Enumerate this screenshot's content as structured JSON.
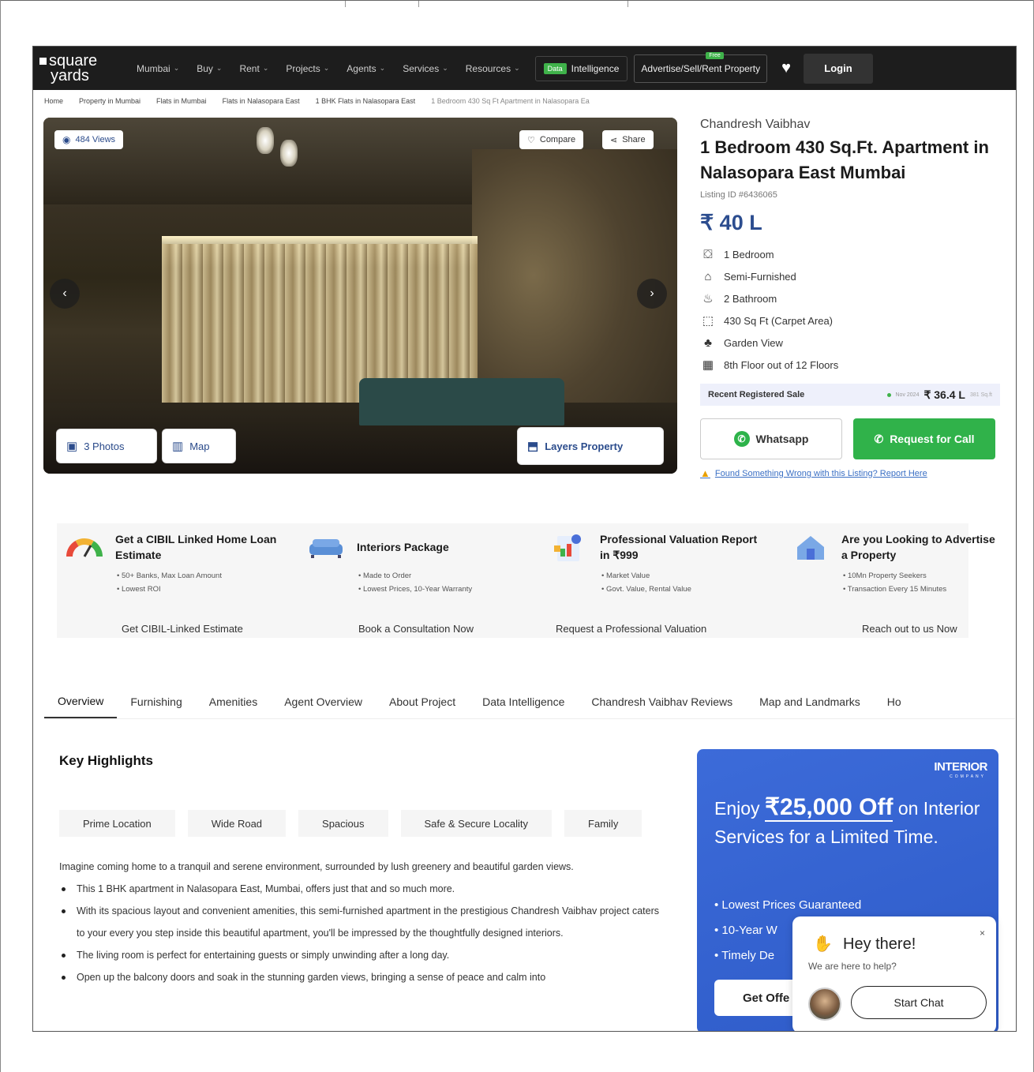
{
  "nav": {
    "logo_top": "square",
    "logo_bottom": "yards",
    "items": [
      {
        "label": "Mumbai"
      },
      {
        "label": "Buy"
      },
      {
        "label": "Rent"
      },
      {
        "label": "Projects"
      },
      {
        "label": "Agents"
      },
      {
        "label": "Services"
      },
      {
        "label": "Resources"
      }
    ],
    "data_tag": "Data",
    "data_label": "Intelligence",
    "advertise_label": "Advertise/Sell/Rent Property",
    "free_tag": "Free",
    "login_label": "Login"
  },
  "breadcrumb": [
    "Home",
    "Property in Mumbai",
    "Flats in Mumbai",
    "Flats in Nalasopara East",
    "1 BHK Flats in Nalasopara East",
    "1 Bedroom 430 Sq Ft Apartment in Nalasopara Ea"
  ],
  "gallery": {
    "views_label": "484 Views",
    "compare_label": "Compare",
    "share_label": "Share",
    "photos_label": "3 Photos",
    "map_label": "Map",
    "layers_label": "Layers Property"
  },
  "listing": {
    "builder": "Chandresh Vaibhav",
    "title": "1 Bedroom 430 Sq.Ft. Apartment in Nalasopara East Mumbai",
    "listing_id": "Listing ID #6436065",
    "price": "₹ 40 L",
    "features": [
      {
        "icon": "bed-icon",
        "label": "1 Bedroom"
      },
      {
        "icon": "sofa-icon",
        "label": "Semi-Furnished"
      },
      {
        "icon": "bathtub-icon",
        "label": "2 Bathroom"
      },
      {
        "icon": "area-icon",
        "label": "430 Sq Ft  (Carpet Area)"
      },
      {
        "icon": "garden-icon",
        "label": "Garden View"
      },
      {
        "icon": "floor-icon",
        "label": "8th Floor out of 12 Floors"
      }
    ],
    "recent_sale_label": "Recent Registered Sale",
    "recent_sale_date": "Nov 2024",
    "recent_sale_amount": "₹ 36.4 L",
    "recent_sale_rate": "381 Sq.ft",
    "whatsapp_label": "Whatsapp",
    "call_label": "Request for Call",
    "report_label": "Found Something Wrong with this Listing? Report Here"
  },
  "services": [
    {
      "title": "Get a CIBIL Linked Home Loan Estimate",
      "points": [
        "50+ Banks, Max Loan Amount",
        "Lowest ROI"
      ],
      "link": "Get CIBIL-Linked Estimate"
    },
    {
      "title": "Interiors Package",
      "points": [
        "Made to Order",
        "Lowest Prices, 10-Year Warranty"
      ],
      "link": "Book a Consultation Now"
    },
    {
      "title": "Professional Valuation Report in ₹999",
      "points": [
        "Market Value",
        "Govt. Value, Rental Value"
      ],
      "link": "Request a Professional Valuation"
    },
    {
      "title": "Are you Looking to Advertise a Property",
      "points": [
        "10Mn Property Seekers",
        "Transaction Every 15 Minutes"
      ],
      "link": "Reach out to us Now"
    }
  ],
  "tabs": [
    "Overview",
    "Furnishing",
    "Amenities",
    "Agent Overview",
    "About Project",
    "Data Intelligence",
    "Chandresh Vaibhav Reviews",
    "Map and Landmarks",
    "Ho"
  ],
  "highlights": {
    "title": "Key Highlights",
    "chips": [
      "Prime Location",
      "Wide Road",
      "Spacious",
      "Safe & Secure Locality",
      "Family"
    ],
    "intro": "Imagine coming home to a tranquil and serene environment, surrounded by lush greenery and beautiful garden views.",
    "bullets": [
      "This 1 BHK apartment in Nalasopara East, Mumbai, offers just that and so much more.",
      "With its spacious layout and convenient amenities, this semi-furnished apartment in the prestigious Chandresh Vaibhav project caters to your every you step inside this beautiful apartment, you'll be impressed by the thoughtfully designed interiors.",
      "The living room is perfect for entertaining guests or simply unwinding after a long day.",
      "Open up the balcony doors and soak in the stunning garden views, bringing a sense of peace and calm into"
    ]
  },
  "promo": {
    "brand": "INTERIOR",
    "brand_sub": "COMPANY",
    "enjoy": "Enjoy",
    "amount": "₹25,000 Off",
    "rest": "on Interior Services for a Limited Time.",
    "points": [
      "Lowest Prices Guaranteed",
      "10-Year W",
      "Timely De"
    ],
    "button": "Get Offe"
  },
  "chat": {
    "greeting": "Hey there!",
    "help": "We are here to help?",
    "close": "×",
    "start_label": "Start Chat"
  }
}
